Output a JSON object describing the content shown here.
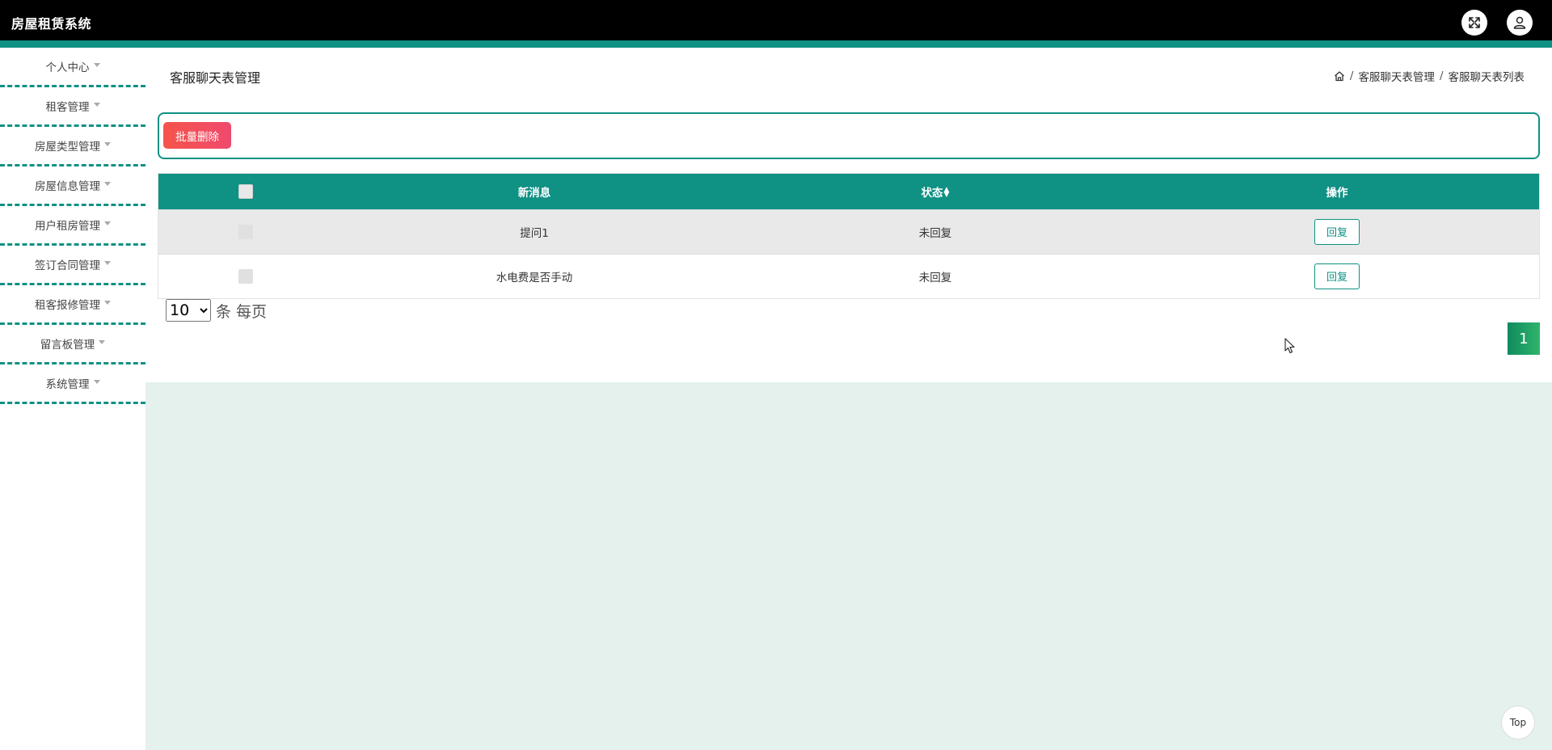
{
  "app": {
    "title": "房屋租赁系统",
    "header_icons": [
      "fullscreen-icon",
      "user-icon"
    ]
  },
  "sidebar": {
    "items": [
      {
        "label": "个人中心"
      },
      {
        "label": "租客管理"
      },
      {
        "label": "房屋类型管理"
      },
      {
        "label": "房屋信息管理"
      },
      {
        "label": "用户租房管理"
      },
      {
        "label": "签订合同管理"
      },
      {
        "label": "租客报修管理"
      },
      {
        "label": "留言板管理"
      },
      {
        "label": "系统管理"
      }
    ]
  },
  "page": {
    "title": "客服聊天表管理",
    "breadcrumb": [
      "客服聊天表管理",
      "客服聊天表列表"
    ]
  },
  "toolbar": {
    "batch_delete_label": "批量删除"
  },
  "table": {
    "columns": [
      "",
      "新消息",
      "状态",
      "操作"
    ],
    "rows": [
      {
        "message": "提问1",
        "status": "未回复",
        "action": "回复"
      },
      {
        "message": "水电费是否手动",
        "status": "未回复",
        "action": "回复"
      }
    ]
  },
  "pagination": {
    "page_size": "10",
    "page_size_options": [
      "10"
    ],
    "page_size_suffix": "条 每页",
    "current_page": "1"
  },
  "back_to_top": {
    "label": "Top"
  },
  "colors": {
    "primary": "#0f9184",
    "header_bg": "#000000",
    "danger": "#f5544b",
    "main_bg": "#e4f1ed"
  }
}
